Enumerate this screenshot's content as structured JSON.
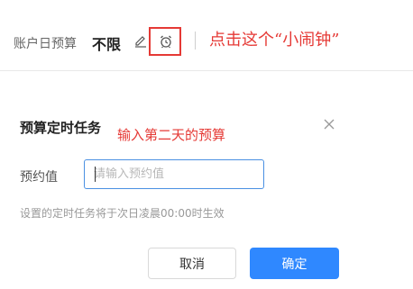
{
  "header": {
    "account_budget_label": "账户日预算",
    "account_budget_value": "不限",
    "edit_icon": "pencil-icon",
    "alarm_icon": "alarm-clock-icon"
  },
  "annotations": {
    "top": "点击这个“小闹钟”",
    "middle": "输入第二天的预算",
    "highlight_color": "#e53935"
  },
  "dialog": {
    "title": "预算定时任务",
    "close_icon": "close-icon",
    "field_label": "预约值",
    "field_placeholder": "请输入预约值",
    "field_value": "",
    "hint": "设置的定时任务将于次日凌晨00:00时生效",
    "cancel_label": "取消",
    "confirm_label": "确定",
    "accent_color": "#2f88ff"
  }
}
